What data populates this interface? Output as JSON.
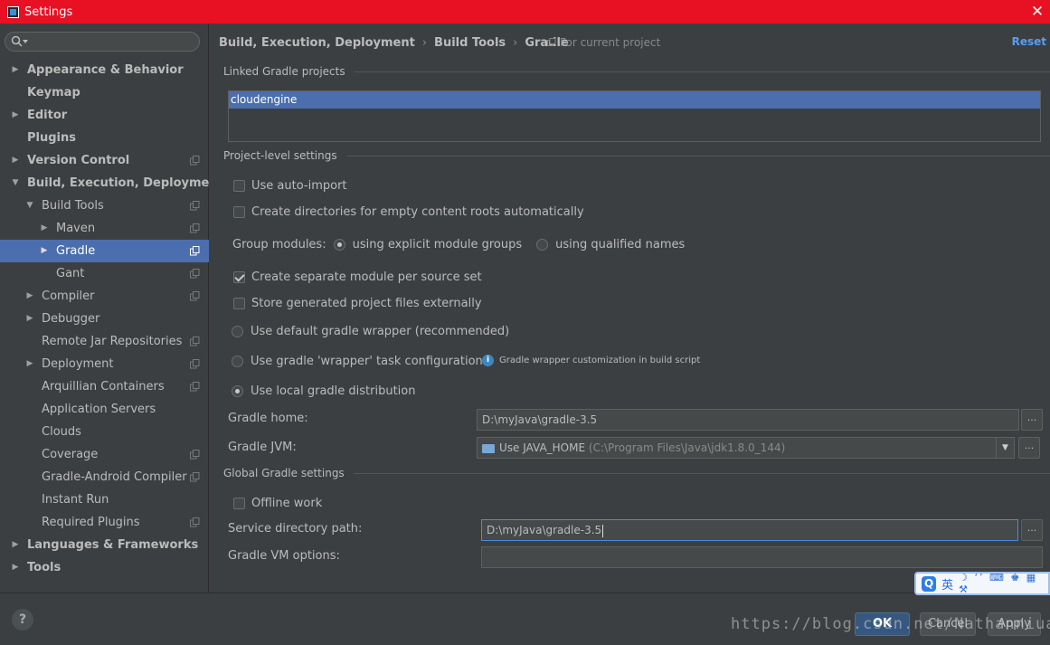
{
  "window": {
    "title": "Settings",
    "close_glyph": "✕",
    "titlebar_color": "#e81123"
  },
  "search": {
    "placeholder": ""
  },
  "sidebar": {
    "items": [
      {
        "label": "Appearance & Behavior",
        "level": 0,
        "arrow": "right",
        "bold": true,
        "project": false
      },
      {
        "label": "Keymap",
        "level": 0,
        "arrow": "none",
        "bold": true,
        "project": false
      },
      {
        "label": "Editor",
        "level": 0,
        "arrow": "right",
        "bold": true,
        "project": false
      },
      {
        "label": "Plugins",
        "level": 0,
        "arrow": "none",
        "bold": true,
        "project": false
      },
      {
        "label": "Version Control",
        "level": 0,
        "arrow": "right",
        "bold": true,
        "project": true
      },
      {
        "label": "Build, Execution, Deployment",
        "level": 0,
        "arrow": "down",
        "bold": true,
        "project": false
      },
      {
        "label": "Build Tools",
        "level": 1,
        "arrow": "down",
        "bold": false,
        "project": true
      },
      {
        "label": "Maven",
        "level": 2,
        "arrow": "right",
        "bold": false,
        "project": true
      },
      {
        "label": "Gradle",
        "level": 2,
        "arrow": "right",
        "bold": false,
        "project": true,
        "selected": true
      },
      {
        "label": "Gant",
        "level": 2,
        "arrow": "none",
        "bold": false,
        "project": true
      },
      {
        "label": "Compiler",
        "level": 1,
        "arrow": "right",
        "bold": false,
        "project": true
      },
      {
        "label": "Debugger",
        "level": 1,
        "arrow": "right",
        "bold": false,
        "project": false
      },
      {
        "label": "Remote Jar Repositories",
        "level": 1,
        "arrow": "none",
        "bold": false,
        "project": true
      },
      {
        "label": "Deployment",
        "level": 1,
        "arrow": "right",
        "bold": false,
        "project": true
      },
      {
        "label": "Arquillian Containers",
        "level": 1,
        "arrow": "none",
        "bold": false,
        "project": true
      },
      {
        "label": "Application Servers",
        "level": 1,
        "arrow": "none",
        "bold": false,
        "project": false
      },
      {
        "label": "Clouds",
        "level": 1,
        "arrow": "none",
        "bold": false,
        "project": false
      },
      {
        "label": "Coverage",
        "level": 1,
        "arrow": "none",
        "bold": false,
        "project": true
      },
      {
        "label": "Gradle-Android Compiler",
        "level": 1,
        "arrow": "none",
        "bold": false,
        "project": true
      },
      {
        "label": "Instant Run",
        "level": 1,
        "arrow": "none",
        "bold": false,
        "project": false
      },
      {
        "label": "Required Plugins",
        "level": 1,
        "arrow": "none",
        "bold": false,
        "project": true
      },
      {
        "label": "Languages & Frameworks",
        "level": 0,
        "arrow": "right",
        "bold": true,
        "project": false
      },
      {
        "label": "Tools",
        "level": 0,
        "arrow": "right",
        "bold": true,
        "project": false
      }
    ]
  },
  "header": {
    "crumbs": [
      "Build, Execution, Deployment",
      "Build Tools",
      "Gradle"
    ],
    "separator": "›",
    "for_current": "For current project",
    "reset": "Reset"
  },
  "linked": {
    "title": "Linked Gradle projects",
    "projects": [
      "cloudengine"
    ]
  },
  "project_level": {
    "title": "Project-level settings",
    "auto_import": {
      "label": "Use auto-import",
      "checked": false
    },
    "create_dirs": {
      "label": "Create directories for empty content roots automatically",
      "checked": false
    },
    "group_modules_label": "Group modules:",
    "group_explicit": {
      "label": "using explicit module groups",
      "checked": true
    },
    "group_qualified": {
      "label": "using qualified names",
      "checked": false
    },
    "separate_module": {
      "label": "Create separate module per source set",
      "checked": true
    },
    "store_external": {
      "label": "Store generated project files externally",
      "checked": false
    },
    "default_wrapper": {
      "label": "Use default gradle wrapper (recommended)",
      "checked": false
    },
    "wrapper_task": {
      "label": "Use gradle 'wrapper' task configuration",
      "checked": false
    },
    "wrapper_hint": "Gradle wrapper customization in build script",
    "local_dist": {
      "label": "Use local gradle distribution",
      "checked": true
    },
    "gradle_home_label": "Gradle home:",
    "gradle_home_value": "D:\\myJava\\gradle-3.5",
    "gradle_jvm_label": "Gradle JVM:",
    "gradle_jvm_value": "Use JAVA_HOME",
    "gradle_jvm_path": "(C:\\Program Files\\Java\\jdk1.8.0_144)",
    "browse": "..."
  },
  "global": {
    "title": "Global Gradle settings",
    "offline": {
      "label": "Offline work",
      "checked": false
    },
    "service_dir_label": "Service directory path:",
    "service_dir_value": "D:\\myJava\\gradle-3.5",
    "vm_options_label": "Gradle VM options:",
    "vm_options_value": ""
  },
  "footer": {
    "help": "?",
    "ok": "OK",
    "cancel": "Cancel",
    "apply": "Apply"
  },
  "ime": {
    "logo": "Q",
    "mode": "英",
    "symbols": "☽ ‘’ ⌨ ♚ ▦ ⚒"
  },
  "watermark": "https://blog.csdn.net/Nathanniuaee"
}
